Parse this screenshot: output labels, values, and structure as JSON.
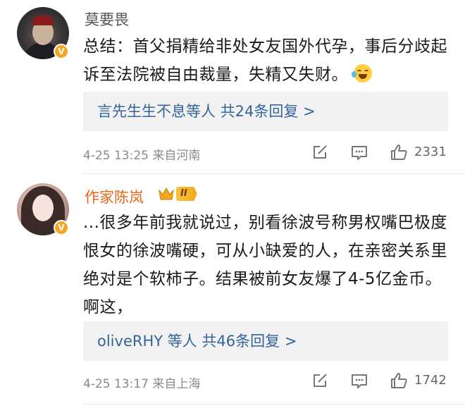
{
  "comments": [
    {
      "author": "莫要畏",
      "verified_badge": "V",
      "text": "总结：首父捐精给非处女友国外代孕，事后分歧起诉至法院被自由裁量，失精又失财。",
      "emoji": "laughing-crying-emoji",
      "replies": {
        "who": "言先生生不息等人",
        "count_text": "共24条回复 >"
      },
      "time": "4-25 13:25",
      "location": "来自河南",
      "likes": "2331"
    },
    {
      "author": "作家陈岚",
      "verified_badge": "V",
      "rank_label": "II",
      "text": "...很多年前我就说过，别看徐波号称男权嘴巴极度恨女的徐波嘴硬，可从小缺爱的人，在亲密关系里绝对是个软柿子。结果被前女友爆了4-5亿金币。啊这，",
      "replies": {
        "who": "oliveRHY 等人",
        "count_text": "共46条回复 >"
      },
      "time": "4-25 13:17",
      "location": "来自上海",
      "likes": "1742"
    }
  ],
  "colors": {
    "accent_name": "#e8671b",
    "link": "#35659a",
    "badge": "#f5a623",
    "meta": "#8a8a8a"
  },
  "icons": [
    "share-icon",
    "comment-icon",
    "like-icon",
    "crown-icon",
    "verified-icon"
  ]
}
